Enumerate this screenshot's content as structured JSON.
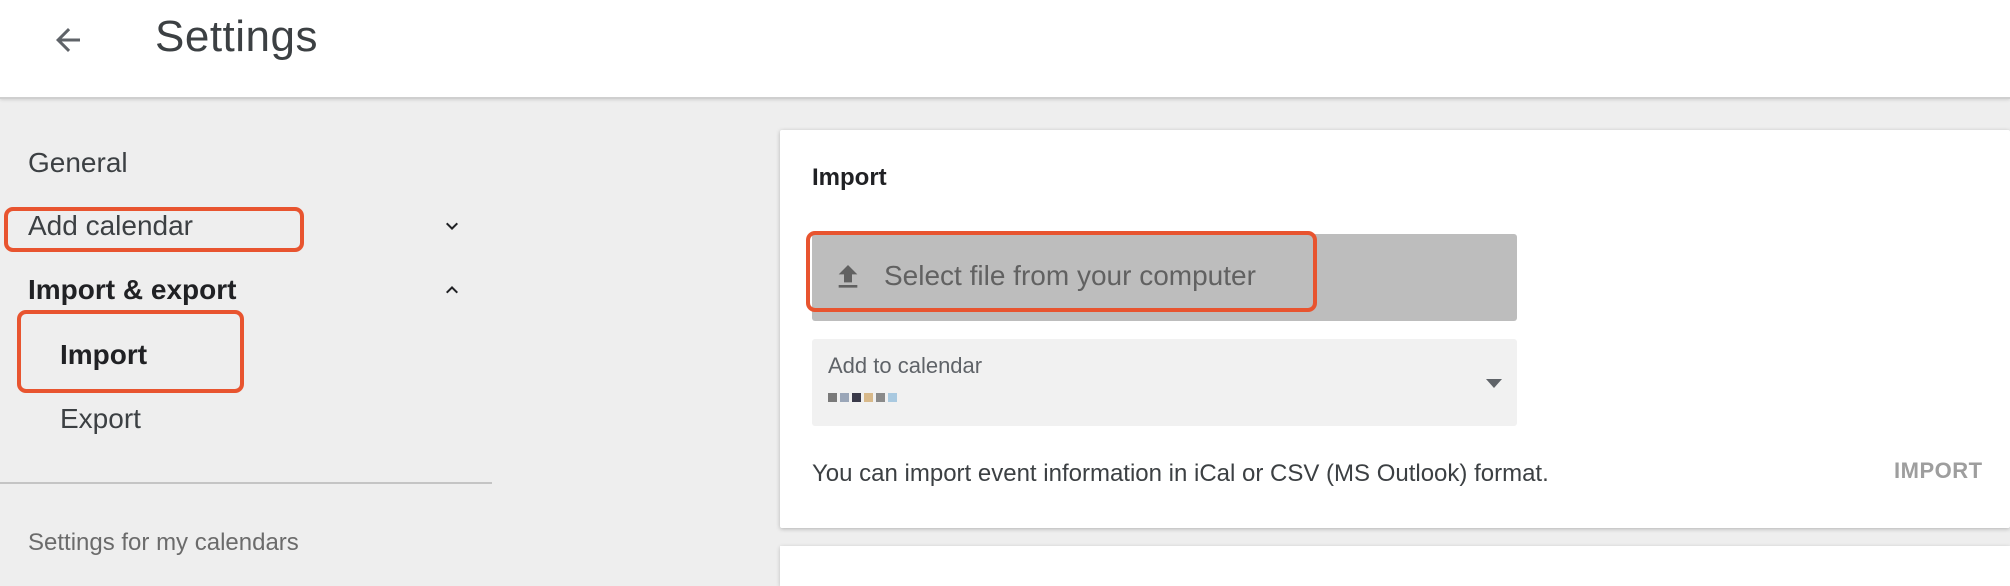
{
  "header": {
    "back_icon": "arrow-back-icon",
    "title": "Settings"
  },
  "sidebar": {
    "items": [
      {
        "label": "General"
      },
      {
        "label": "Add calendar",
        "icon": "chevron-down-icon"
      },
      {
        "label": "Import & export",
        "icon": "chevron-up-icon"
      },
      {
        "label": "Import"
      },
      {
        "label": "Export"
      }
    ],
    "section_label": "Settings for my calendars"
  },
  "import_card": {
    "title": "Import",
    "file_button": {
      "icon": "upload-icon",
      "label": "Select file from your computer"
    },
    "calendar_select": {
      "label": "Add to calendar"
    },
    "info_text": "You can import event information in iCal or CSV (MS Outlook) format.",
    "import_button": "IMPORT"
  },
  "colors": {
    "highlight": "#e8542f",
    "file_button_bg": "#bdbdbd",
    "page_bg": "#eeeeee"
  }
}
